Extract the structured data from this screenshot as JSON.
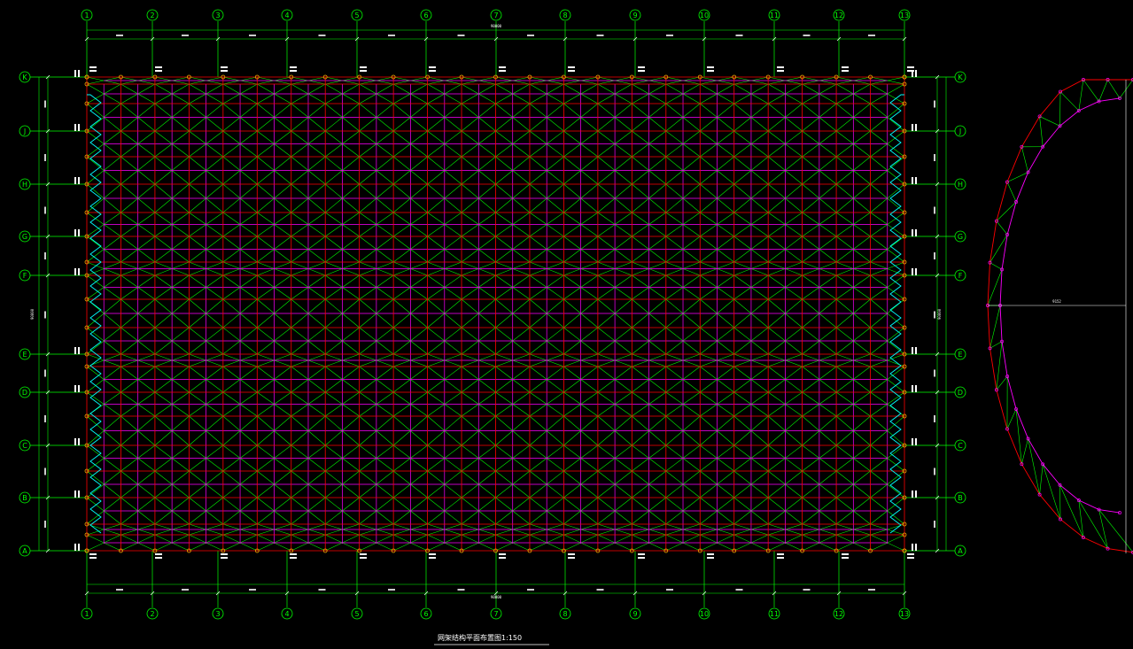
{
  "drawing": {
    "title": "网架结构平面布置图1:150",
    "colors": {
      "background": "#000000",
      "grid_axis": "#00ff00",
      "chord_top": "#ff0000",
      "chord_bottom": "#ff00ff",
      "web": "#00ff00",
      "support": "#00ffff",
      "node": "#ff00ff",
      "dimension": "#ffffff",
      "support_node": "#ff3333"
    }
  },
  "axes": {
    "vertical": [
      "1",
      "2",
      "3",
      "4",
      "5",
      "6",
      "7",
      "8",
      "9",
      "10",
      "11",
      "12",
      "13"
    ],
    "horizontal": [
      "K",
      "J",
      "H",
      "G",
      "F",
      "E",
      "D",
      "C",
      "B",
      "A"
    ]
  },
  "dimensions": {
    "top_total": "90000",
    "bottom_total": "90000",
    "left_total": "90000",
    "right_total": "90000",
    "section_span": "9152"
  }
}
